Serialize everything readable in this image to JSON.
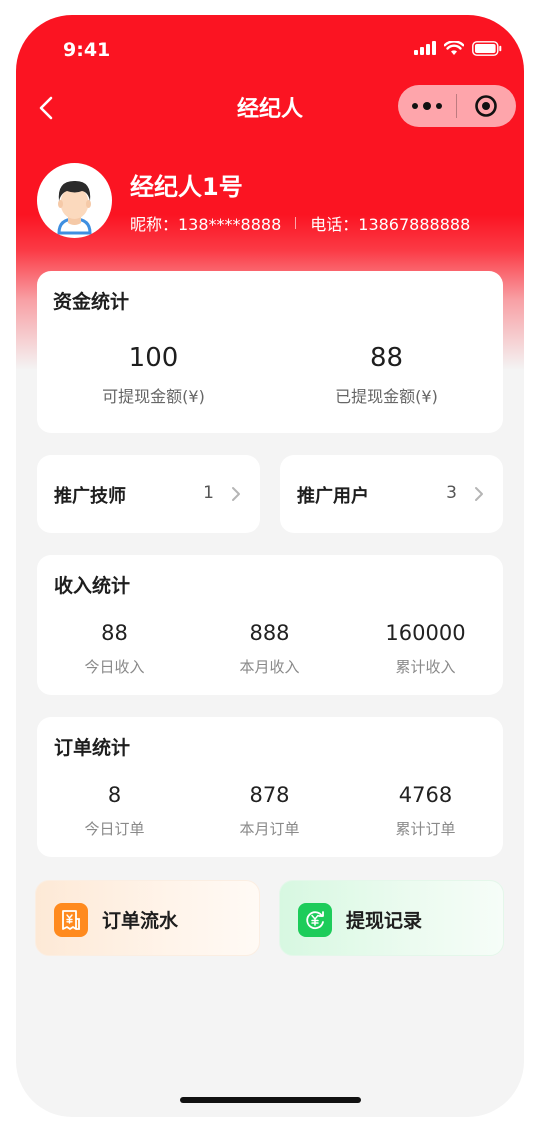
{
  "status_bar": {
    "time": "9:41"
  },
  "nav": {
    "title": "经纪人"
  },
  "profile": {
    "name": "经纪人1号",
    "nickname": "昵称：138****8888",
    "phone": "电话：13867888888"
  },
  "funds": {
    "title": "资金统计",
    "items": [
      {
        "value": "100",
        "label": "可提现金额(¥)"
      },
      {
        "value": "88",
        "label": "已提现金额(¥)"
      }
    ]
  },
  "promotion": {
    "technicians": {
      "label": "推广技师",
      "count": "1"
    },
    "users": {
      "label": "推广用户",
      "count": "3"
    }
  },
  "income": {
    "title": "收入统计",
    "items": [
      {
        "value": "88",
        "label": "今日收入"
      },
      {
        "value": "888",
        "label": "本月收入"
      },
      {
        "value": "160000",
        "label": "累计收入"
      }
    ]
  },
  "orders": {
    "title": "订单统计",
    "items": [
      {
        "value": "8",
        "label": "今日订单"
      },
      {
        "value": "878",
        "label": "本月订单"
      },
      {
        "value": "4768",
        "label": "累计订单"
      }
    ]
  },
  "actions": {
    "order_flow": {
      "label": "订单流水",
      "icon": "receipt-icon",
      "color": "#ff8a1e"
    },
    "withdraw_records": {
      "label": "提现记录",
      "icon": "yuan-exchange-icon",
      "color": "#1dcc5a"
    }
  },
  "theme": {
    "primary": "#fb1422",
    "background": "#f4f4f4"
  }
}
